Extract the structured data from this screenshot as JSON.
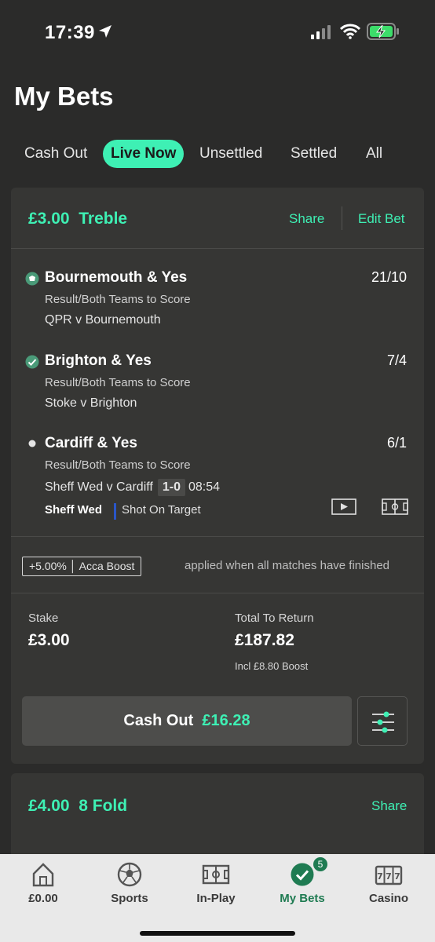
{
  "status_bar": {
    "time": "17:39"
  },
  "page": {
    "title": "My Bets"
  },
  "tabs": [
    {
      "label": "Cash Out"
    },
    {
      "label": "Live Now"
    },
    {
      "label": "Unsettled"
    },
    {
      "label": "Settled"
    },
    {
      "label": "All"
    }
  ],
  "bet1": {
    "stake_head": "£3.00",
    "type": "Treble",
    "share": "Share",
    "edit": "Edit Bet",
    "selections": [
      {
        "title": "Bournemouth & Yes",
        "odds": "21/10",
        "market": "Result/Both Teams to Score",
        "match": "QPR v Bournemouth"
      },
      {
        "title": "Brighton & Yes",
        "odds": "7/4",
        "market": "Result/Both Teams to Score",
        "match": "Stoke v Brighton"
      },
      {
        "title": "Cardiff & Yes",
        "odds": "6/1",
        "market": "Result/Both Teams to Score",
        "match": "Sheff Wed v Cardiff",
        "score": "1-0",
        "time": "08:54"
      }
    ],
    "event": {
      "team": "Sheff Wed",
      "text": "Shot On Target"
    },
    "boost_badge": "+5.00% │ Acca Boost",
    "boost_note": "applied when all matches have finished",
    "stake_label": "Stake",
    "stake_value": "£3.00",
    "return_label": "Total To Return",
    "return_value": "£187.82",
    "boost_incl": "Incl £8.80 Boost",
    "cashout_label": "Cash Out",
    "cashout_value": "£16.28"
  },
  "bet2": {
    "stake_head": "£4.00",
    "type": "8 Fold",
    "share": "Share"
  },
  "nav": [
    {
      "label": "£0.00",
      "icon": "home-icon"
    },
    {
      "label": "Sports",
      "icon": "football-icon"
    },
    {
      "label": "In-Play",
      "icon": "pitch-icon"
    },
    {
      "label": "My Bets",
      "icon": "check-icon",
      "badge": "5"
    },
    {
      "label": "Casino",
      "icon": "slot-machine-icon"
    }
  ],
  "colors": {
    "accent": "#3ef0b4",
    "background": "#2b2b2a",
    "card": "#363634",
    "nav_active": "#1f7b52"
  }
}
